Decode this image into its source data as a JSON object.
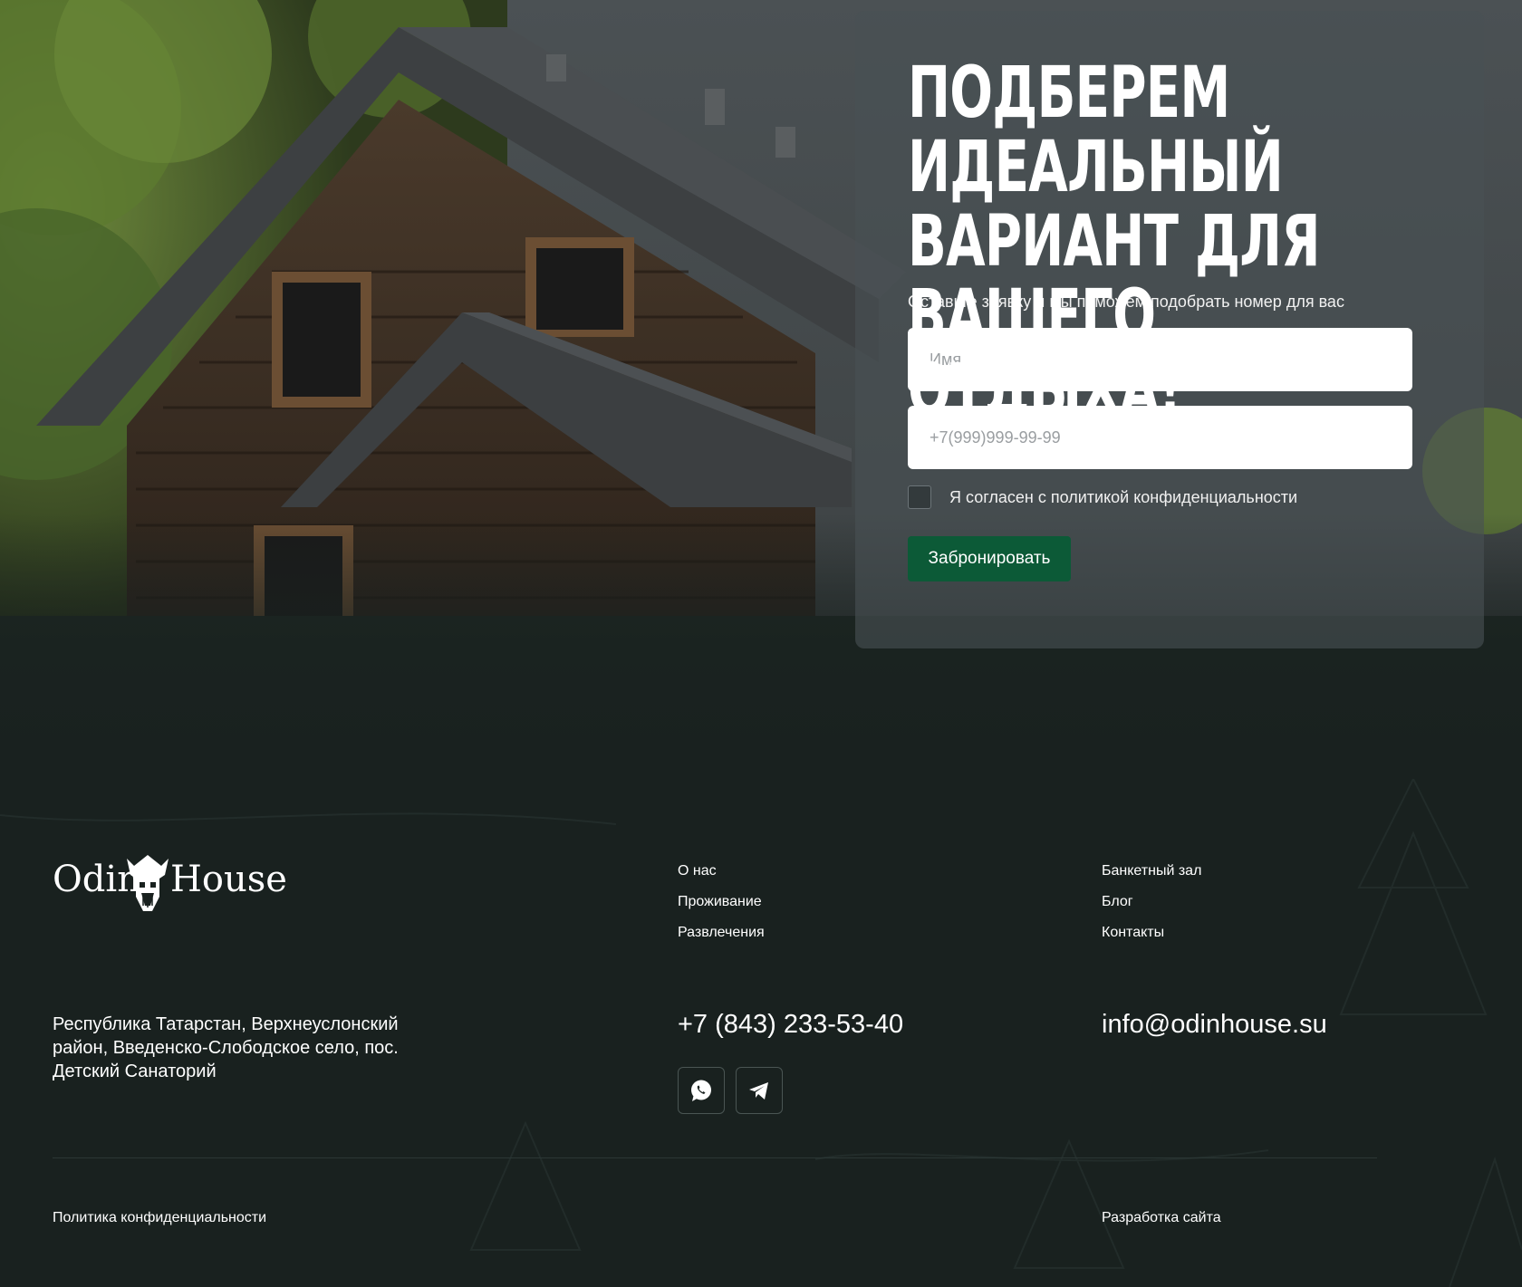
{
  "hero": {
    "form": {
      "title": "Подберем идеальный вариант для вашего отдыха!",
      "subtitle": "Оставьте заявку и мы поможем подобрать номер для вас",
      "name_placeholder": "Имя",
      "phone_placeholder": "+7(999)999-99-99",
      "consent_label": "Я согласен с политикой конфиденциальности",
      "consent_checked": false,
      "submit_label": "Забронировать"
    }
  },
  "footer": {
    "logo": {
      "word_left": "Odin",
      "word_right": "House",
      "emblem_icon": "viking-helmet-icon"
    },
    "nav_col1": [
      "О нас",
      "Проживание",
      "Развлечения"
    ],
    "nav_col2": [
      "Банкетный зал",
      "Блог",
      "Контакты"
    ],
    "address": "Республика Татарстан, Верхнеуслонский район, Введенско-Слободское село, пос. Детский Санаторий",
    "phone": "+7 (843) 233-53-40",
    "email": "info@odinhouse.su",
    "socials": [
      {
        "name": "whatsapp",
        "icon": "whatsapp-icon"
      },
      {
        "name": "telegram",
        "icon": "telegram-icon"
      }
    ],
    "privacy_link": "Политика конфиденциальности",
    "dev_link": "Разработка сайта"
  },
  "colors": {
    "page_bg": "#19211f",
    "button_green": "#0c5a37",
    "form_card": "rgba(72,80,84,0.62)"
  }
}
